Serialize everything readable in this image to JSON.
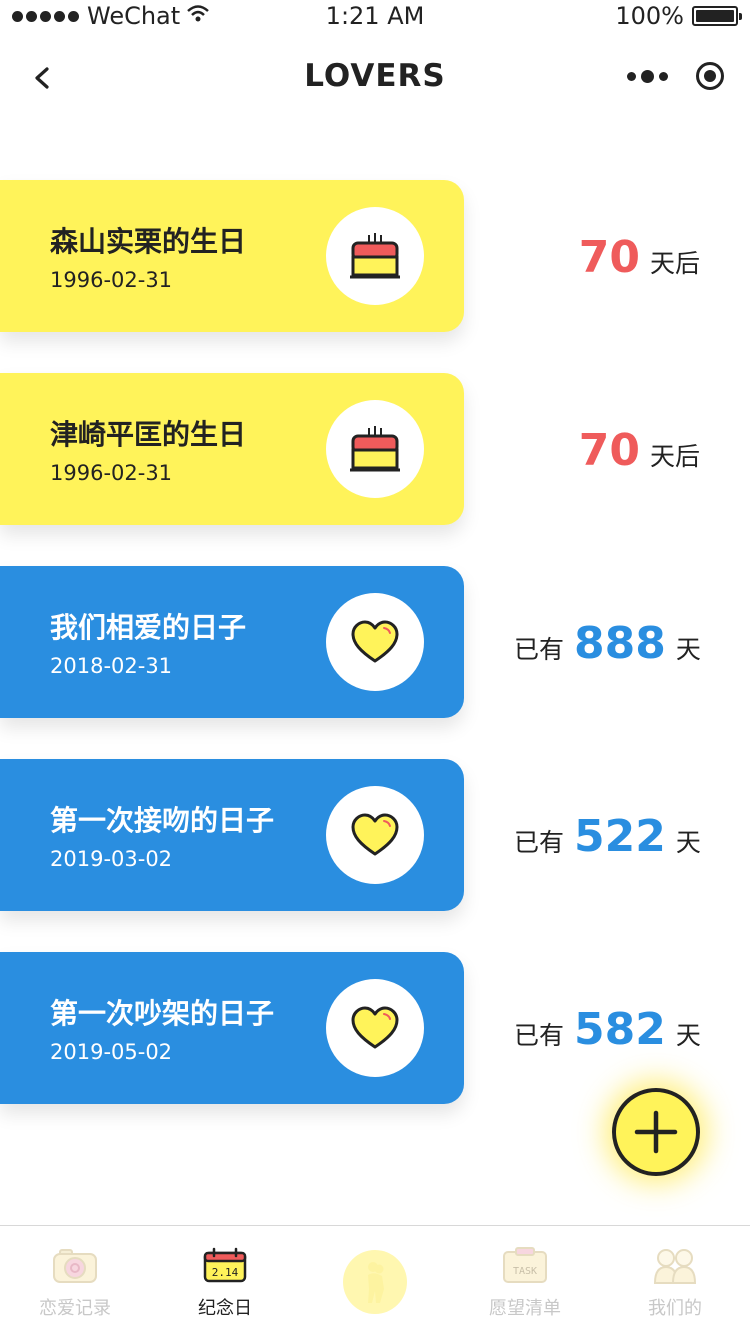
{
  "status_bar": {
    "carrier": "WeChat",
    "time": "1:21 AM",
    "battery_percent": "100%",
    "battery_level": 1.0
  },
  "nav": {
    "title": "LOVERS",
    "back_icon": "chevron-left-icon",
    "more_icon": "more-dots-icon",
    "close_icon": "target-icon"
  },
  "colors": {
    "yellow": "#fff35a",
    "blue": "#2a8ee0",
    "red_number": "#ef5b5b"
  },
  "cards": [
    {
      "title": "森山实栗的生日",
      "date": "1996-02-31",
      "icon": "birthday-cake-icon",
      "style": "yellow",
      "prefix": "",
      "number": "70",
      "unit": "天后"
    },
    {
      "title": "津崎平匡的生日",
      "date": "1996-02-31",
      "icon": "birthday-cake-icon",
      "style": "yellow",
      "prefix": "",
      "number": "70",
      "unit": "天后"
    },
    {
      "title": "我们相爱的日子",
      "date": "2018-02-31",
      "icon": "heart-icon",
      "style": "blue",
      "prefix": "已有",
      "number": "888",
      "unit": "天"
    },
    {
      "title": "第一次接吻的日子",
      "date": "2019-03-02",
      "icon": "heart-icon",
      "style": "blue",
      "prefix": "已有",
      "number": "522",
      "unit": "天"
    },
    {
      "title": "第一次吵架的日子",
      "date": "2019-05-02",
      "icon": "heart-icon",
      "style": "blue",
      "prefix": "已有",
      "number": "582",
      "unit": "天"
    }
  ],
  "fab": {
    "icon": "plus-icon"
  },
  "tabs": [
    {
      "label": "恋爱记录",
      "icon": "camera-icon",
      "active": false
    },
    {
      "label": "纪念日",
      "icon": "calendar-icon",
      "active": true,
      "icon_text": "2.14"
    },
    {
      "label": "",
      "icon": "couple-icon",
      "active": false
    },
    {
      "label": "愿望清单",
      "icon": "task-icon",
      "active": false,
      "icon_text": "TASK"
    },
    {
      "label": "我们的",
      "icon": "people-icon",
      "active": false
    }
  ]
}
